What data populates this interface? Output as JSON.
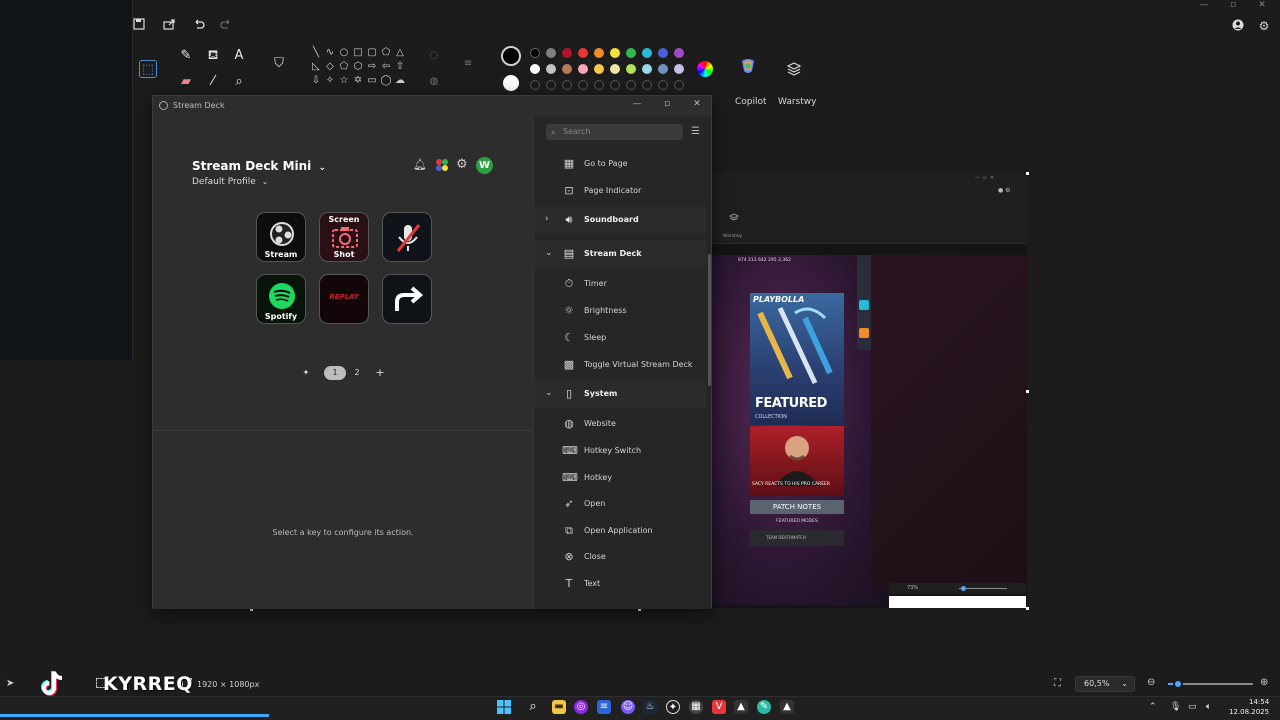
{
  "paint": {
    "ribbon_labels": {
      "copilot": "Copilot",
      "layers": "Warstwy"
    },
    "palette_row1": [
      "#000000",
      "#7f7f7f",
      "#b5122d",
      "#e8363c",
      "#f48a2a",
      "#f6e03b",
      "#2db94d",
      "#29b8d8",
      "#4a5fd9",
      "#a34bc6"
    ],
    "palette_row2": [
      "#ffffff",
      "#c3c3c3",
      "#b97a57",
      "#f6a6b8",
      "#f8c843",
      "#efe4a0",
      "#b4e35b",
      "#9ad9ea",
      "#7092be",
      "#c8bfe7"
    ],
    "status": {
      "dimensions": "1920 × 1080px",
      "zoom": "60,5%",
      "zoom_value": 0.12
    }
  },
  "streamdeck": {
    "window_title": "Stream Deck",
    "device_name": "Stream Deck Mini",
    "profile_name": "Default Profile",
    "avatar_letter": "W",
    "keys": [
      {
        "label": "Stream",
        "top": ""
      },
      {
        "label": "Shot",
        "top": "Screen"
      },
      {
        "label": "",
        "top": ""
      },
      {
        "label": "Spotify",
        "top": ""
      },
      {
        "label": "REPLAY",
        "top": ""
      },
      {
        "label": "",
        "top": ""
      }
    ],
    "pages": {
      "pin": "✦",
      "p1": "1",
      "p2": "2",
      "add": "+"
    },
    "hint": "Select a key to configure its action.",
    "search_placeholder": "Search",
    "actions": {
      "goto_page": "Go to Page",
      "page_indicator": "Page Indicator",
      "soundboard": "Soundboard",
      "stream_deck": "Stream Deck",
      "timer": "Timer",
      "brightness": "Brightness",
      "sleep": "Sleep",
      "toggle_virtual": "Toggle Virtual Stream Deck",
      "system": "System",
      "website": "Website",
      "hotkey_switch": "Hotkey Switch",
      "hotkey": "Hotkey",
      "open": "Open",
      "open_application": "Open Application",
      "close": "Close",
      "text": "Text"
    }
  },
  "canvas_content": {
    "featured": "FEATURED",
    "collection": "COLLECTION",
    "caption": "SACY REACTS TO HIS PRO CAREER",
    "patch_notes": "PATCH NOTES",
    "featured_modes": "FEATURED MODES",
    "mode": "TEAM DEATHMATCH",
    "brand": "PLAYBOLLA",
    "top_stats": "874  213  642  295  2,362",
    "inner_ribbon_label": "Warstwy",
    "inner_zoom": "73%"
  },
  "watermark": {
    "text": "KYRREQ"
  },
  "taskbar": {
    "time": "14:54",
    "date": "12.08.2025",
    "video_progress": 0.21
  }
}
